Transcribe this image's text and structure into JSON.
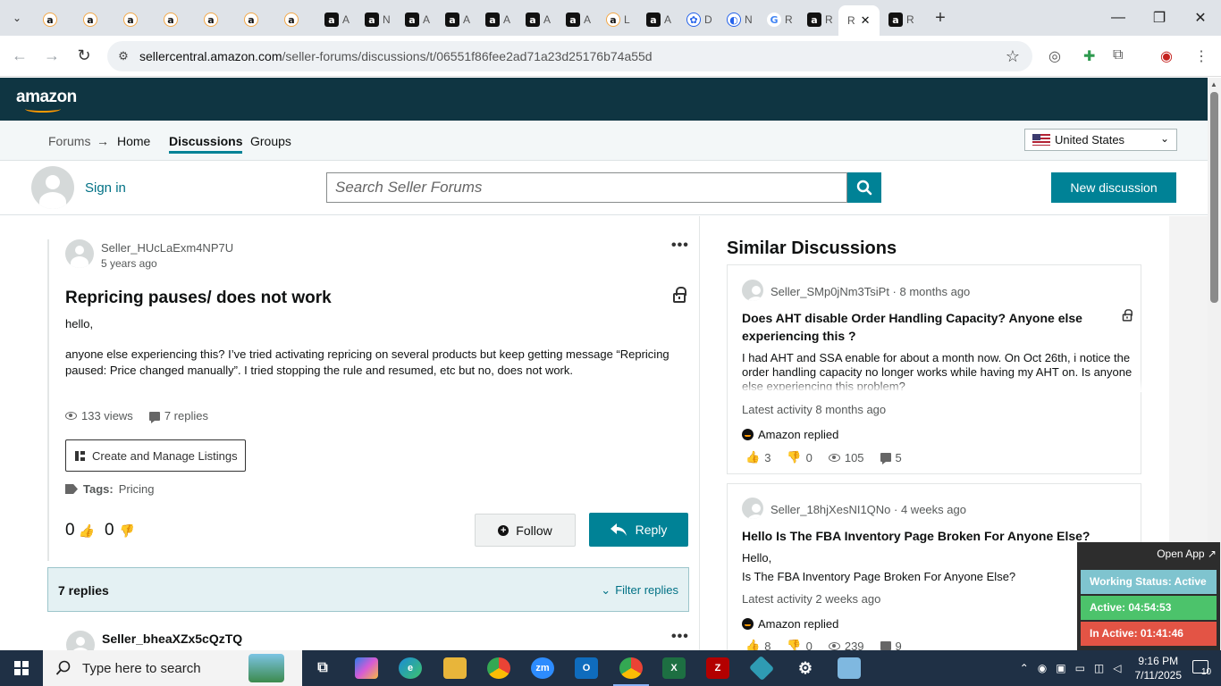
{
  "browser": {
    "tabs": [
      {
        "icon": "amazon-smile-icon",
        "letter": ""
      },
      {
        "icon": "amazon-smile-icon",
        "letter": ""
      },
      {
        "icon": "amazon-smile-icon",
        "letter": ""
      },
      {
        "icon": "amazon-smile-icon",
        "letter": ""
      },
      {
        "icon": "amazon-smile-icon",
        "letter": ""
      },
      {
        "icon": "amazon-smile-icon",
        "letter": ""
      },
      {
        "icon": "amazon-smile-icon",
        "letter": ""
      },
      {
        "icon": "amazon-box-icon",
        "letter": "A"
      },
      {
        "icon": "amazon-box-icon",
        "letter": "N"
      },
      {
        "icon": "amazon-box-icon",
        "letter": "A"
      },
      {
        "icon": "amazon-box-icon",
        "letter": "A"
      },
      {
        "icon": "amazon-box-icon",
        "letter": "A"
      },
      {
        "icon": "amazon-box-icon",
        "letter": "A"
      },
      {
        "icon": "amazon-box-icon",
        "letter": "A"
      },
      {
        "icon": "amazon-smile-icon",
        "letter": "L"
      },
      {
        "icon": "amazon-box-icon",
        "letter": "A"
      },
      {
        "icon": "gear-circle-icon",
        "letter": "D"
      },
      {
        "icon": "circle-globe-icon",
        "letter": "N"
      },
      {
        "icon": "google-icon",
        "letter": "R"
      },
      {
        "icon": "amazon-box-icon",
        "letter": "R"
      },
      {
        "icon": "",
        "letter": "R",
        "active": true
      },
      {
        "icon": "amazon-box-icon",
        "letter": "R"
      }
    ],
    "url_host": "sellercentral.amazon.com",
    "url_path": "/seller-forums/discussions/t/06551f86fee2ad71a23d25176b74a55d"
  },
  "header": {
    "logo": "amazon"
  },
  "nav": {
    "forums": "Forums",
    "home": "Home",
    "discussions": "Discussions",
    "groups": "Groups",
    "country": "United States"
  },
  "toolbar": {
    "sign_in": "Sign in",
    "search_placeholder": "Search Seller Forums",
    "new_discussion": "New discussion"
  },
  "post": {
    "author": "Seller_HUcLaExm4NP7U",
    "time": "5 years ago",
    "title": "Repricing pauses/ does not work",
    "body": [
      "hello,",
      "anyone else experiencing this? I’ve tried activating repricing on several products but keep getting message “Repricing paused: Price changed manually”. I tried stopping the rule and resumed, etc but no, does not work."
    ],
    "views": "133 views",
    "replies": "7 replies",
    "category": "Create and Manage Listings",
    "tags_label": "Tags:",
    "tags_value": "Pricing",
    "upvotes": "0",
    "downvotes": "0",
    "follow": "Follow",
    "reply": "Reply"
  },
  "replies_section": {
    "count": "7 replies",
    "filter": "Filter replies",
    "first_author": "Seller_bheaXZx5cQzTQ"
  },
  "similar": {
    "title": "Similar Discussions",
    "items": [
      {
        "author": "Seller_SMp0jNm3TsiPt",
        "age": "8 months ago",
        "title": "Does AHT disable Order Handling Capacity? Anyone else experiencing this ?",
        "body": "I had AHT and SSA enable for about a month now. On Oct 26th, i notice the order handling capacity no longer works while having my AHT on. Is anyone else experiencing this problem?",
        "latest": "Latest activity 8 months ago",
        "amazon": "Amazon replied",
        "likes": "3",
        "dislikes": "0",
        "views": "105",
        "comments": "5"
      },
      {
        "author": "Seller_18hjXesNI1QNo",
        "age": "4 weeks ago",
        "title": "Hello Is The FBA Inventory Page Broken For Anyone Else?",
        "body": "Hello,",
        "body2": "Is The FBA Inventory Page Broken For Anyone Else?",
        "latest": "Latest activity 2 weeks ago",
        "amazon": "Amazon replied",
        "likes": "8",
        "dislikes": "0",
        "views": "239",
        "comments": "9"
      }
    ]
  },
  "tracker": {
    "open_app": "Open App ↗",
    "status": "Working Status: Active",
    "active": "Active: 04:54:53",
    "inactive": "In Active: 01:41:46",
    "colors": {
      "status": "#7fc4cf",
      "active": "#4cc36b",
      "inactive": "#e35445"
    }
  },
  "taskbar": {
    "search_placeholder": "Type here to search",
    "time": "9:16 PM",
    "date": "7/11/2025",
    "notifications": "10"
  },
  "colors": {
    "header_bg": "#0f3542",
    "teal": "#008296",
    "link": "#007185"
  }
}
